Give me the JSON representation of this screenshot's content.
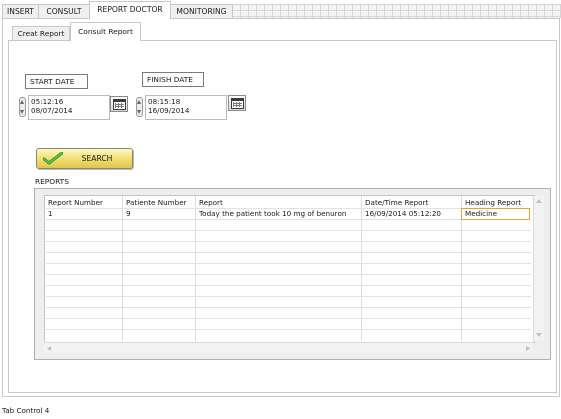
{
  "top_tabs": [
    {
      "label": "INSERT"
    },
    {
      "label": "CONSULT"
    },
    {
      "label": "REPORT DOCTOR"
    },
    {
      "label": "MONITORING"
    }
  ],
  "sub_tabs": [
    {
      "label": "Creat Report"
    },
    {
      "label": "Consult Report"
    }
  ],
  "start_date": {
    "label": "START DATE",
    "time": "05:12:16",
    "date": "08/07/2014"
  },
  "finish_date": {
    "label": "FINISH DATE",
    "time": "08:15:18",
    "date": "16/09/2014"
  },
  "search_button": {
    "label": "SEARCH"
  },
  "reports": {
    "label": "REPORTS",
    "columns": [
      "Report Number",
      "Patiente Number",
      "Report",
      "Date/Time Report",
      "Heading Report"
    ],
    "rows": [
      [
        "1",
        "9",
        "Today the patient took 10 mg of benuron",
        "16/09/2014 05:12:20",
        "Medicine"
      ]
    ]
  },
  "footer_label": "Tab Control 4"
}
